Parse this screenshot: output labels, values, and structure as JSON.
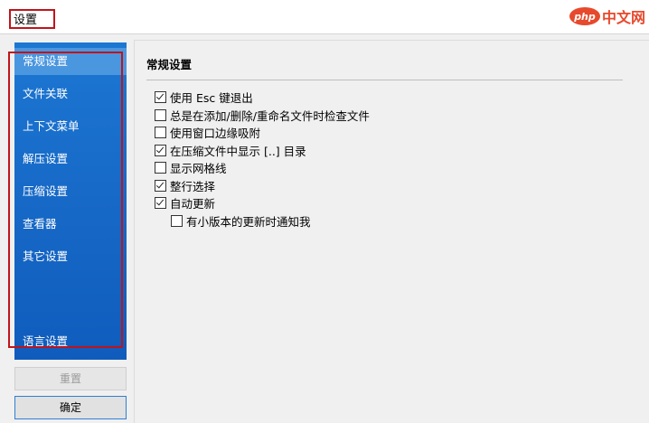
{
  "window": {
    "title": "设置"
  },
  "watermark": {
    "logo": "php",
    "text": "中文网"
  },
  "sidebar": {
    "items": [
      {
        "label": "常规设置",
        "active": true
      },
      {
        "label": "文件关联",
        "active": false
      },
      {
        "label": "上下文菜单",
        "active": false
      },
      {
        "label": "解压设置",
        "active": false
      },
      {
        "label": "压缩设置",
        "active": false
      },
      {
        "label": "查看器",
        "active": false
      },
      {
        "label": "其它设置",
        "active": false
      },
      {
        "label": "语言设置",
        "active": false
      }
    ]
  },
  "buttons": {
    "reset": "重置",
    "ok": "确定"
  },
  "content": {
    "section_title": "常规设置",
    "options": [
      {
        "label": "使用 Esc 键退出",
        "checked": true
      },
      {
        "label": "总是在添加/删除/重命名文件时检查文件",
        "checked": false
      },
      {
        "label": "使用窗口边缘吸附",
        "checked": false
      },
      {
        "label": "在压缩文件中显示 [..] 目录",
        "checked": true
      },
      {
        "label": "显示网格线",
        "checked": false
      },
      {
        "label": "整行选择",
        "checked": true
      },
      {
        "label": "自动更新",
        "checked": true
      },
      {
        "label": "有小版本的更新时通知我",
        "checked": false
      }
    ]
  },
  "colors": {
    "sidebar_bg": "#1769c7",
    "sidebar_active": "#4a96df",
    "annotation": "#c0141a",
    "window_bg": "#f0f0f0"
  }
}
